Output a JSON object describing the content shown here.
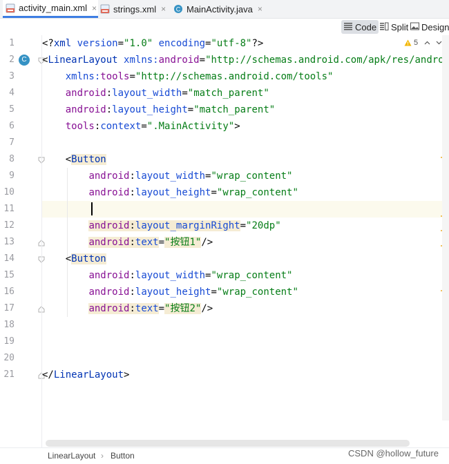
{
  "tabs": [
    {
      "label": "activity_main.xml",
      "icon": "xml-file-icon",
      "active": true
    },
    {
      "label": "strings.xml",
      "icon": "xml-file-icon",
      "active": false
    },
    {
      "label": "MainActivity.java",
      "icon": "class-icon",
      "active": false
    }
  ],
  "tab_close_glyph": "×",
  "editor_modes": {
    "code": "Code",
    "split": "Split",
    "design": "Design"
  },
  "inspection": {
    "warnings": "5"
  },
  "class_gutter_letter": "C",
  "line_numbers": [
    "1",
    "2",
    "3",
    "4",
    "5",
    "6",
    "7",
    "8",
    "9",
    "10",
    "11",
    "12",
    "13",
    "14",
    "15",
    "16",
    "17",
    "18",
    "19",
    "20",
    "21"
  ],
  "code_lines": [
    [
      {
        "t": "pi",
        "v": "<?"
      },
      {
        "t": "tag",
        "v": "xml"
      },
      {
        "t": "attr",
        "v": " version"
      },
      {
        "t": "pi",
        "v": "="
      },
      {
        "t": "val",
        "v": "\"1.0\""
      },
      {
        "t": "attr",
        "v": " encoding"
      },
      {
        "t": "pi",
        "v": "="
      },
      {
        "t": "val",
        "v": "\"utf-8\""
      },
      {
        "t": "pi",
        "v": "?>"
      }
    ],
    [
      {
        "t": "pi",
        "v": "<"
      },
      {
        "t": "tag",
        "v": "LinearLayout"
      },
      {
        "t": "pi",
        "v": " "
      },
      {
        "t": "attr",
        "v": "xmlns:"
      },
      {
        "t": "ns",
        "v": "android"
      },
      {
        "t": "pi",
        "v": "="
      },
      {
        "t": "val",
        "v": "\"http://schemas.android.com/apk/res/android\""
      }
    ],
    [
      {
        "t": "pi",
        "v": "    "
      },
      {
        "t": "attr",
        "v": "xmlns:"
      },
      {
        "t": "ns",
        "v": "tools"
      },
      {
        "t": "pi",
        "v": "="
      },
      {
        "t": "val",
        "v": "\"http://schemas.android.com/tools\""
      }
    ],
    [
      {
        "t": "pi",
        "v": "    "
      },
      {
        "t": "ns",
        "v": "android"
      },
      {
        "t": "pi",
        "v": ":"
      },
      {
        "t": "attr",
        "v": "layout_width"
      },
      {
        "t": "pi",
        "v": "="
      },
      {
        "t": "val",
        "v": "\"match_parent\""
      }
    ],
    [
      {
        "t": "pi",
        "v": "    "
      },
      {
        "t": "ns",
        "v": "android"
      },
      {
        "t": "pi",
        "v": ":"
      },
      {
        "t": "attr",
        "v": "layout_height"
      },
      {
        "t": "pi",
        "v": "="
      },
      {
        "t": "val",
        "v": "\"match_parent\""
      }
    ],
    [
      {
        "t": "pi",
        "v": "    "
      },
      {
        "t": "ns",
        "v": "tools"
      },
      {
        "t": "pi",
        "v": ":"
      },
      {
        "t": "attr",
        "v": "context"
      },
      {
        "t": "pi",
        "v": "="
      },
      {
        "t": "val",
        "v": "\".MainActivity\""
      },
      {
        "t": "pi",
        "v": ">"
      }
    ],
    [],
    [
      {
        "t": "pi",
        "v": "    <"
      },
      {
        "t": "tag hl",
        "v": "Button"
      }
    ],
    [
      {
        "t": "pi",
        "v": "        "
      },
      {
        "t": "ns",
        "v": "android"
      },
      {
        "t": "pi",
        "v": ":"
      },
      {
        "t": "attr",
        "v": "layout_width"
      },
      {
        "t": "pi",
        "v": "="
      },
      {
        "t": "val",
        "v": "\"wrap_content\""
      }
    ],
    [
      {
        "t": "pi",
        "v": "        "
      },
      {
        "t": "ns",
        "v": "android"
      },
      {
        "t": "pi",
        "v": ":"
      },
      {
        "t": "attr",
        "v": "layout_height"
      },
      {
        "t": "pi",
        "v": "="
      },
      {
        "t": "val",
        "v": "\"wrap_content\""
      }
    ],
    [],
    [
      {
        "t": "pi",
        "v": "        "
      },
      {
        "t": "ns hl",
        "v": "android"
      },
      {
        "t": "pi hl",
        "v": ":"
      },
      {
        "t": "attr hl",
        "v": "layout_marginRight"
      },
      {
        "t": "pi",
        "v": "="
      },
      {
        "t": "val",
        "v": "\"20dp\""
      }
    ],
    [
      {
        "t": "pi",
        "v": "        "
      },
      {
        "t": "ns hl",
        "v": "android"
      },
      {
        "t": "pi hl",
        "v": ":"
      },
      {
        "t": "attr hl",
        "v": "text"
      },
      {
        "t": "pi",
        "v": "="
      },
      {
        "t": "val hl",
        "v": "\"按钮1\""
      },
      {
        "t": "pi",
        "v": "/>"
      }
    ],
    [
      {
        "t": "pi",
        "v": "    <"
      },
      {
        "t": "tag hl",
        "v": "Button"
      }
    ],
    [
      {
        "t": "pi",
        "v": "        "
      },
      {
        "t": "ns",
        "v": "android"
      },
      {
        "t": "pi",
        "v": ":"
      },
      {
        "t": "attr",
        "v": "layout_width"
      },
      {
        "t": "pi",
        "v": "="
      },
      {
        "t": "val",
        "v": "\"wrap_content\""
      }
    ],
    [
      {
        "t": "pi",
        "v": "        "
      },
      {
        "t": "ns",
        "v": "android"
      },
      {
        "t": "pi",
        "v": ":"
      },
      {
        "t": "attr",
        "v": "layout_height"
      },
      {
        "t": "pi",
        "v": "="
      },
      {
        "t": "val",
        "v": "\"wrap_content\""
      }
    ],
    [
      {
        "t": "pi",
        "v": "        "
      },
      {
        "t": "ns hl",
        "v": "android"
      },
      {
        "t": "pi hl",
        "v": ":"
      },
      {
        "t": "attr hl",
        "v": "text"
      },
      {
        "t": "pi",
        "v": "="
      },
      {
        "t": "val hl",
        "v": "\"按钮2\""
      },
      {
        "t": "pi",
        "v": "/>"
      }
    ],
    [],
    [],
    [],
    [
      {
        "t": "pi",
        "v": "</"
      },
      {
        "t": "tag",
        "v": "LinearLayout"
      },
      {
        "t": "pi",
        "v": ">"
      }
    ]
  ],
  "current_line_number": "11",
  "breadcrumbs": [
    "LinearLayout",
    "Button"
  ],
  "breadcrumb_separator": "›",
  "watermark": "CSDN @hollow_future",
  "colors": {
    "accent": "#3d7ee3",
    "tag": "#0033b3",
    "attribute": "#174ad4",
    "namespace": "#871094",
    "string": "#067d17",
    "warning": "#f0c05a"
  }
}
